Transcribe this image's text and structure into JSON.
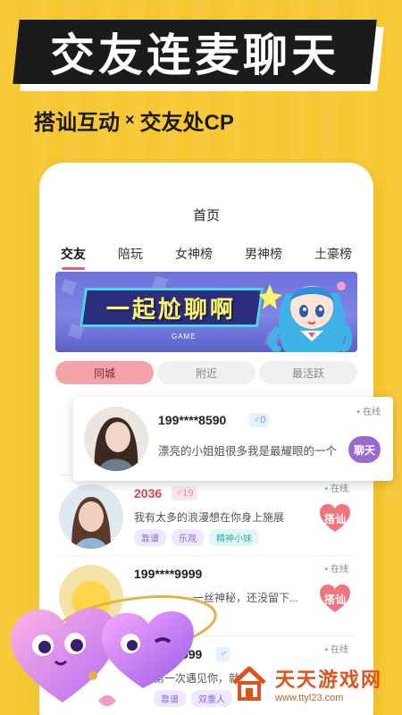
{
  "promo": {
    "headline": "交友连麦聊天",
    "sub_left": "搭讪互动",
    "sub_sep": "×",
    "sub_right": "交友处CP"
  },
  "app": {
    "title": "首页",
    "tabs": [
      {
        "label": "交友",
        "active": true
      },
      {
        "label": "陪玩",
        "active": false
      },
      {
        "label": "女神榜",
        "active": false
      },
      {
        "label": "男神榜",
        "active": false
      },
      {
        "label": "土豪榜",
        "active": false
      }
    ],
    "banner": {
      "text": "一起尬聊啊",
      "tag": "GAME"
    },
    "filters": [
      {
        "label": "同城",
        "active": true
      },
      {
        "label": "附近",
        "active": false
      },
      {
        "label": "最活跃",
        "active": false
      }
    ],
    "featured_user": {
      "name": "199****8590",
      "gender_icon": "male-icon",
      "gender_symbol": "♂",
      "age": "0",
      "status": "在线",
      "bio": "漂亮的小姐姐很多我是最耀眼的一个",
      "action": "聊天"
    },
    "users": [
      {
        "name": "2036",
        "gender_symbol": "♂",
        "age": "19",
        "status": "在线",
        "bio": "我有太多的浪漫想在你身上施展",
        "tags": [
          "靠谱",
          "乐观",
          "精神小妹"
        ],
        "action": "搭讪"
      },
      {
        "name": "199****9999",
        "gender_symbol": "",
        "age": "",
        "status": "在线",
        "bio": "一丝神秘，还没留下...",
        "tags": [],
        "action": "搭讪"
      },
      {
        "name": "137****3999",
        "gender_symbol": "♂",
        "age": "",
        "status": "在线",
        "bio": "第一次遇见你，就",
        "tags": [
          "靠谱",
          "双重人"
        ],
        "action": "搭讪"
      }
    ]
  },
  "watermark": {
    "cn": "天天游戏网",
    "en": "www.ttyl23.com"
  },
  "colors": {
    "background": "#f7c731",
    "accent_pink": "#e8616d",
    "heart_button": "#f1737d",
    "chat_button": "#9a6ad0",
    "online_dot": "#4cc06a"
  }
}
